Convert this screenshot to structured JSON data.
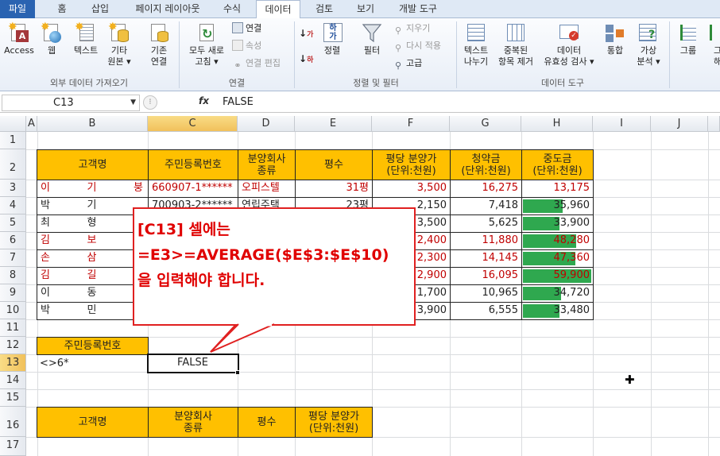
{
  "ribbon": {
    "tabs": [
      "파일",
      "홈",
      "삽입",
      "페이지 레이아웃",
      "수식",
      "데이터",
      "검토",
      "보기",
      "개발 도구"
    ],
    "active_tab": "데이터",
    "groups": {
      "external": {
        "label": "외부 데이터 가져오기",
        "access": "Access",
        "web": "웹",
        "text": "텍스트",
        "other_1": "기타",
        "other_2": "원본",
        "existing_1": "기존",
        "existing_2": "연결"
      },
      "connections": {
        "label": "연결",
        "refresh_1": "모두 새로",
        "refresh_2": "고침",
        "conn": "연결",
        "props": "속성",
        "edit_links": "연결 편집"
      },
      "sort_filter": {
        "label": "정렬 및 필터",
        "sort": "정렬",
        "filter": "필터",
        "clear": "지우기",
        "reapply": "다시 적용",
        "advanced": "고급"
      },
      "data_tools": {
        "label": "데이터 도구",
        "text_to_cols_1": "텍스트",
        "text_to_cols_2": "나누기",
        "remove_dup_1": "중복된",
        "remove_dup_2": "항목 제거",
        "validation_1": "데이터",
        "validation_2": "유효성 검사",
        "consolidate": "통합",
        "whatif_1": "가상",
        "whatif_2": "분석"
      },
      "outline": {
        "group": "그룹",
        "ungroup_1": "그",
        "ungroup_2": "해"
      }
    }
  },
  "formula_bar": {
    "name_box": "C13",
    "fx": "fx",
    "formula": "FALSE"
  },
  "sheet": {
    "columns": [
      "A",
      "B",
      "C",
      "D",
      "E",
      "F",
      "G",
      "H",
      "I",
      "J"
    ],
    "rows": [
      "1",
      "2",
      "3",
      "4",
      "5",
      "6",
      "7",
      "8",
      "9",
      "10",
      "11",
      "12",
      "13",
      "14",
      "15",
      "16",
      "17"
    ],
    "header": {
      "name": "고객명",
      "ssn": "주민등록번호",
      "type_1": "분양회사",
      "type_2": "종류",
      "area": "평수",
      "price_1": "평당 분양가",
      "price_2": "(단위:천원)",
      "sub_1": "청약금",
      "sub_2": "(단위:천원)",
      "mid_1": "중도금",
      "mid_2": "(단위:천원)"
    },
    "data_rows": [
      {
        "name_l": "이",
        "name_m": "기",
        "name_r": "붕",
        "ssn": "660907-1******",
        "type": "오피스텔",
        "area": "31평",
        "price": "3,500",
        "sub": "16,275",
        "mid": "13,175",
        "mid_ratio": 0.0,
        "red": true
      },
      {
        "name_l": "박",
        "name_m": "기",
        "name_r": "",
        "ssn": "",
        "type": "",
        "area": "",
        "price": "2,150",
        "sub": "7,418",
        "mid": "35,960",
        "mid_ratio": 0.58,
        "red": false
      },
      {
        "name_l": "최",
        "name_m": "형",
        "name_r": "",
        "ssn": "",
        "type": "",
        "area": "",
        "price": "3,500",
        "sub": "5,625",
        "mid": "33,900",
        "mid_ratio": 0.54,
        "red": false
      },
      {
        "name_l": "김",
        "name_m": "보",
        "name_r": "",
        "ssn": "",
        "type": "",
        "area": "",
        "price": "2,400",
        "sub": "11,880",
        "mid": "48,280",
        "mid_ratio": 0.78,
        "red": true
      },
      {
        "name_l": "손",
        "name_m": "삼",
        "name_r": "",
        "ssn": "",
        "type": "",
        "area": "",
        "price": "2,300",
        "sub": "14,145",
        "mid": "47,360",
        "mid_ratio": 0.77,
        "red": true
      },
      {
        "name_l": "김",
        "name_m": "길",
        "name_r": "",
        "ssn": "",
        "type": "",
        "area": "",
        "price": "2,900",
        "sub": "16,095",
        "mid": "59,900",
        "mid_ratio": 1.0,
        "red": true
      },
      {
        "name_l": "이",
        "name_m": "동",
        "name_r": "",
        "ssn": "",
        "type": "",
        "area": "",
        "price": "1,700",
        "sub": "10,965",
        "mid": "34,720",
        "mid_ratio": 0.56,
        "red": false
      },
      {
        "name_l": "박",
        "name_m": "민",
        "name_r": "",
        "ssn": "",
        "type": "",
        "area": "",
        "price": "3,900",
        "sub": "6,555",
        "mid": "33,480",
        "mid_ratio": 0.54,
        "red": false
      }
    ],
    "row4_partial": {
      "ssn": "700903-2******",
      "type": "연립주택",
      "area": "23평"
    },
    "criteria_header": "주민등록번호",
    "criteria_value": "<>6*",
    "result_value": "FALSE",
    "output_header": {
      "name": "고객명",
      "type_1": "분양회사",
      "type_2": "종류",
      "area": "평수",
      "price_1": "평당 분양가",
      "price_2": "(단위:천원)"
    },
    "colors": {
      "header_fill": "#ffc000",
      "databar": "#2fa84f",
      "red_text": "#c00000"
    }
  },
  "callout": {
    "line1": "[C13] 셀에는",
    "line2": "=E3>=AVERAGE($E$3:$E$10)",
    "line3": "을 입력해야 합니다."
  }
}
